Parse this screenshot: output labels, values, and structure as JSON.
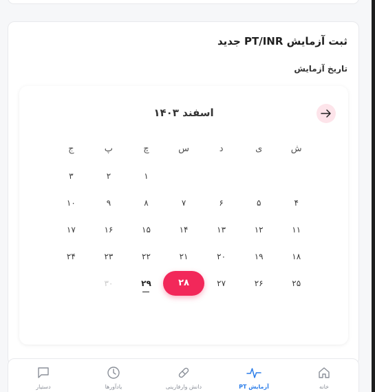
{
  "form": {
    "title": "ثبت آزمایش PT/INR جدید",
    "date_label": "تاریخ آزمایش"
  },
  "calendar": {
    "month_title": "اسفند  ۱۴۰۳",
    "weekdays": [
      "ش",
      "ی",
      "د",
      "س",
      "چ",
      "پ",
      "ج"
    ],
    "days": [
      "",
      "",
      "",
      "",
      "۱",
      "۲",
      "۳",
      "۴",
      "۵",
      "۶",
      "۷",
      "۸",
      "۹",
      "۱۰",
      "۱۱",
      "۱۲",
      "۱۳",
      "۱۴",
      "۱۵",
      "۱۶",
      "۱۷",
      "۱۸",
      "۱۹",
      "۲۰",
      "۲۱",
      "۲۲",
      "۲۳",
      "۲۴",
      "۲۵",
      "۲۶",
      "۲۷",
      "۲۸",
      "۲۹",
      "۳۰",
      ""
    ],
    "selected_day": "۲۸",
    "today_day": "۲۹",
    "disabled_days": [
      "۳۰"
    ],
    "accent_color": "#f2285a"
  },
  "bottom_nav": {
    "items": [
      {
        "label": "خانه",
        "icon": "home-icon"
      },
      {
        "label": "آزمایش PT",
        "icon": "pulse-icon",
        "active": true
      },
      {
        "label": "دانش وارفارینی",
        "icon": "pill-icon"
      },
      {
        "label": "یادآورها",
        "icon": "clock-icon"
      },
      {
        "label": "دستیار",
        "icon": "chat-icon"
      }
    ],
    "active_color": "#2b7de9"
  }
}
